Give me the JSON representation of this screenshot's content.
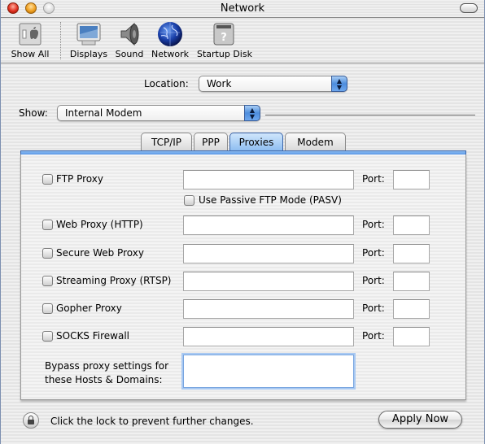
{
  "window": {
    "title": "Network"
  },
  "toolbar": {
    "items": [
      {
        "label": "Show All",
        "icon": "show-all-icon"
      },
      {
        "label": "Displays",
        "icon": "display-monitor-icon"
      },
      {
        "label": "Sound",
        "icon": "speaker-icon"
      },
      {
        "label": "Network",
        "icon": "globe-icon"
      },
      {
        "label": "Startup Disk",
        "icon": "hard-disk-icon"
      }
    ]
  },
  "location": {
    "label": "Location:",
    "value": "Work"
  },
  "show": {
    "label": "Show:",
    "value": "Internal Modem"
  },
  "tabs": [
    {
      "label": "TCP/IP",
      "active": false
    },
    {
      "label": "PPP",
      "active": false
    },
    {
      "label": "Proxies",
      "active": true
    },
    {
      "label": "Modem",
      "active": false
    }
  ],
  "proxies": {
    "port_label": "Port:",
    "rows": [
      {
        "label": "FTP Proxy",
        "checked": false,
        "host": "",
        "port": ""
      },
      {
        "label": "Web Proxy (HTTP)",
        "checked": false,
        "host": "",
        "port": ""
      },
      {
        "label": "Secure Web Proxy",
        "checked": false,
        "host": "",
        "port": ""
      },
      {
        "label": "Streaming Proxy (RTSP)",
        "checked": false,
        "host": "",
        "port": ""
      },
      {
        "label": "Gopher Proxy",
        "checked": false,
        "host": "",
        "port": ""
      },
      {
        "label": "SOCKS Firewall",
        "checked": false,
        "host": "",
        "port": ""
      }
    ],
    "passive_ftp": {
      "label": "Use Passive FTP Mode (PASV)",
      "checked": false
    },
    "bypass": {
      "label_line1": "Bypass proxy settings for",
      "label_line2": "these Hosts & Domains:",
      "value": ""
    }
  },
  "footer": {
    "lock_text": "Click the lock to prevent further changes.",
    "apply_label": "Apply Now"
  }
}
